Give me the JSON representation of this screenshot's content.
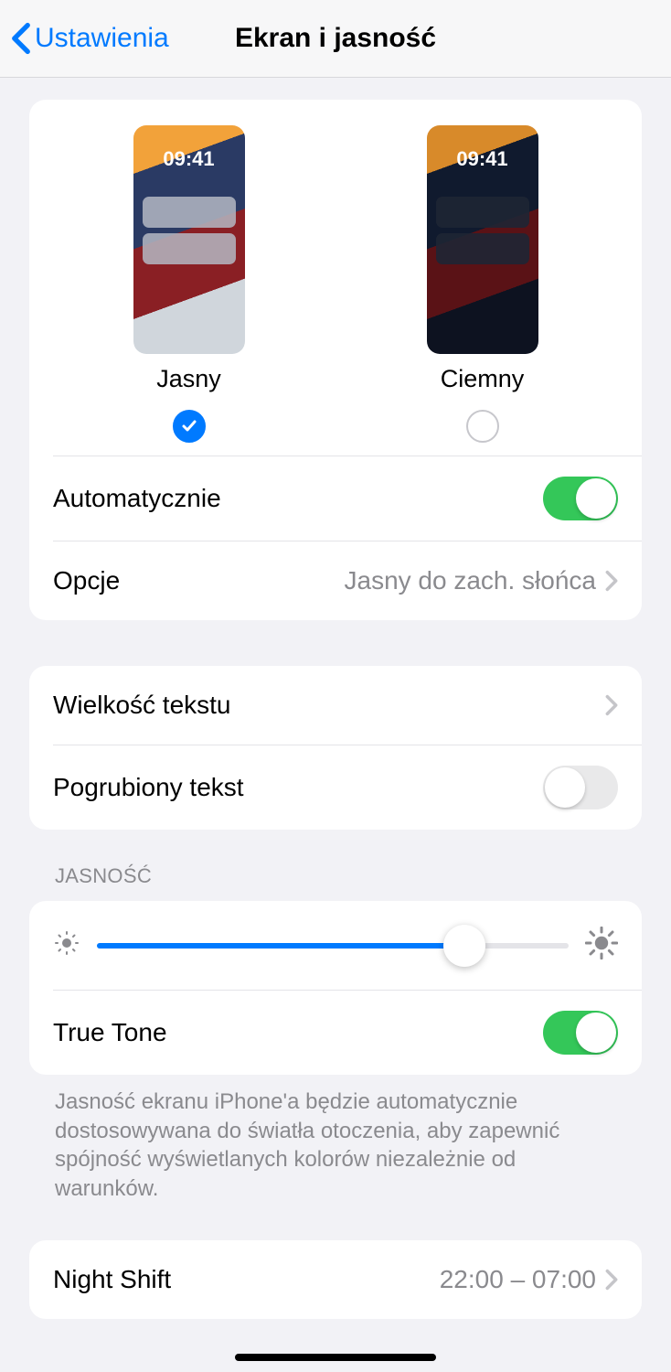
{
  "header": {
    "back_label": "Ustawienia",
    "title": "Ekran i jasność"
  },
  "appearance": {
    "preview_time": "09:41",
    "light_label": "Jasny",
    "dark_label": "Ciemny",
    "selected": "light",
    "automatic_label": "Automatycznie",
    "automatic_on": true,
    "options_label": "Opcje",
    "options_detail": "Jasny do zach. słońca"
  },
  "text_group": {
    "text_size_label": "Wielkość tekstu",
    "bold_text_label": "Pogrubiony tekst",
    "bold_text_on": false
  },
  "brightness": {
    "section_label": "JASNOŚĆ",
    "value_percent": 78,
    "true_tone_label": "True Tone",
    "true_tone_on": true,
    "footer": "Jasność ekranu iPhone'a będzie automatycznie dostosowywana do światła otoczenia, aby zapewnić spójność wyświetlanych kolorów niezależnie od warunków."
  },
  "night_shift": {
    "label": "Night Shift",
    "detail": "22:00 – 07:00"
  }
}
